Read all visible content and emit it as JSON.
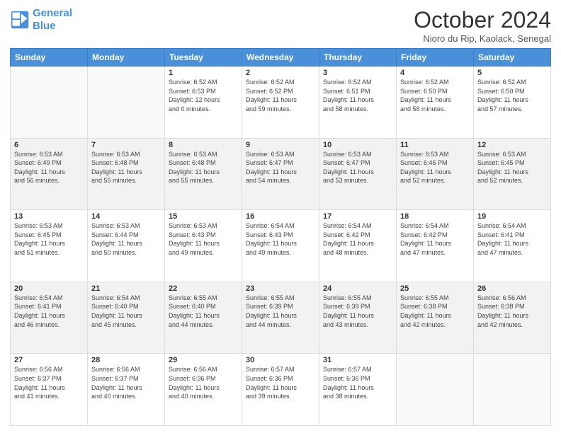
{
  "header": {
    "logo_line1": "General",
    "logo_line2": "Blue",
    "month_title": "October 2024",
    "location": "Nioro du Rip, Kaolack, Senegal"
  },
  "days_of_week": [
    "Sunday",
    "Monday",
    "Tuesday",
    "Wednesday",
    "Thursday",
    "Friday",
    "Saturday"
  ],
  "weeks": [
    [
      {
        "day": "",
        "info": ""
      },
      {
        "day": "",
        "info": ""
      },
      {
        "day": "1",
        "info": "Sunrise: 6:52 AM\nSunset: 6:53 PM\nDaylight: 12 hours\nand 0 minutes."
      },
      {
        "day": "2",
        "info": "Sunrise: 6:52 AM\nSunset: 6:52 PM\nDaylight: 11 hours\nand 59 minutes."
      },
      {
        "day": "3",
        "info": "Sunrise: 6:52 AM\nSunset: 6:51 PM\nDaylight: 11 hours\nand 58 minutes."
      },
      {
        "day": "4",
        "info": "Sunrise: 6:52 AM\nSunset: 6:50 PM\nDaylight: 11 hours\nand 58 minutes."
      },
      {
        "day": "5",
        "info": "Sunrise: 6:52 AM\nSunset: 6:50 PM\nDaylight: 11 hours\nand 57 minutes."
      }
    ],
    [
      {
        "day": "6",
        "info": "Sunrise: 6:53 AM\nSunset: 6:49 PM\nDaylight: 11 hours\nand 56 minutes."
      },
      {
        "day": "7",
        "info": "Sunrise: 6:53 AM\nSunset: 6:48 PM\nDaylight: 11 hours\nand 55 minutes."
      },
      {
        "day": "8",
        "info": "Sunrise: 6:53 AM\nSunset: 6:48 PM\nDaylight: 11 hours\nand 55 minutes."
      },
      {
        "day": "9",
        "info": "Sunrise: 6:53 AM\nSunset: 6:47 PM\nDaylight: 11 hours\nand 54 minutes."
      },
      {
        "day": "10",
        "info": "Sunrise: 6:53 AM\nSunset: 6:47 PM\nDaylight: 11 hours\nand 53 minutes."
      },
      {
        "day": "11",
        "info": "Sunrise: 6:53 AM\nSunset: 6:46 PM\nDaylight: 11 hours\nand 52 minutes."
      },
      {
        "day": "12",
        "info": "Sunrise: 6:53 AM\nSunset: 6:45 PM\nDaylight: 11 hours\nand 52 minutes."
      }
    ],
    [
      {
        "day": "13",
        "info": "Sunrise: 6:53 AM\nSunset: 6:45 PM\nDaylight: 11 hours\nand 51 minutes."
      },
      {
        "day": "14",
        "info": "Sunrise: 6:53 AM\nSunset: 6:44 PM\nDaylight: 11 hours\nand 50 minutes."
      },
      {
        "day": "15",
        "info": "Sunrise: 6:53 AM\nSunset: 6:43 PM\nDaylight: 11 hours\nand 49 minutes."
      },
      {
        "day": "16",
        "info": "Sunrise: 6:54 AM\nSunset: 6:43 PM\nDaylight: 11 hours\nand 49 minutes."
      },
      {
        "day": "17",
        "info": "Sunrise: 6:54 AM\nSunset: 6:42 PM\nDaylight: 11 hours\nand 48 minutes."
      },
      {
        "day": "18",
        "info": "Sunrise: 6:54 AM\nSunset: 6:42 PM\nDaylight: 11 hours\nand 47 minutes."
      },
      {
        "day": "19",
        "info": "Sunrise: 6:54 AM\nSunset: 6:41 PM\nDaylight: 11 hours\nand 47 minutes."
      }
    ],
    [
      {
        "day": "20",
        "info": "Sunrise: 6:54 AM\nSunset: 6:41 PM\nDaylight: 11 hours\nand 46 minutes."
      },
      {
        "day": "21",
        "info": "Sunrise: 6:54 AM\nSunset: 6:40 PM\nDaylight: 11 hours\nand 45 minutes."
      },
      {
        "day": "22",
        "info": "Sunrise: 6:55 AM\nSunset: 6:40 PM\nDaylight: 11 hours\nand 44 minutes."
      },
      {
        "day": "23",
        "info": "Sunrise: 6:55 AM\nSunset: 6:39 PM\nDaylight: 11 hours\nand 44 minutes."
      },
      {
        "day": "24",
        "info": "Sunrise: 6:55 AM\nSunset: 6:39 PM\nDaylight: 11 hours\nand 43 minutes."
      },
      {
        "day": "25",
        "info": "Sunrise: 6:55 AM\nSunset: 6:38 PM\nDaylight: 11 hours\nand 42 minutes."
      },
      {
        "day": "26",
        "info": "Sunrise: 6:56 AM\nSunset: 6:38 PM\nDaylight: 11 hours\nand 42 minutes."
      }
    ],
    [
      {
        "day": "27",
        "info": "Sunrise: 6:56 AM\nSunset: 6:37 PM\nDaylight: 11 hours\nand 41 minutes."
      },
      {
        "day": "28",
        "info": "Sunrise: 6:56 AM\nSunset: 6:37 PM\nDaylight: 11 hours\nand 40 minutes."
      },
      {
        "day": "29",
        "info": "Sunrise: 6:56 AM\nSunset: 6:36 PM\nDaylight: 11 hours\nand 40 minutes."
      },
      {
        "day": "30",
        "info": "Sunrise: 6:57 AM\nSunset: 6:36 PM\nDaylight: 11 hours\nand 39 minutes."
      },
      {
        "day": "31",
        "info": "Sunrise: 6:57 AM\nSunset: 6:36 PM\nDaylight: 11 hours\nand 38 minutes."
      },
      {
        "day": "",
        "info": ""
      },
      {
        "day": "",
        "info": ""
      }
    ]
  ]
}
